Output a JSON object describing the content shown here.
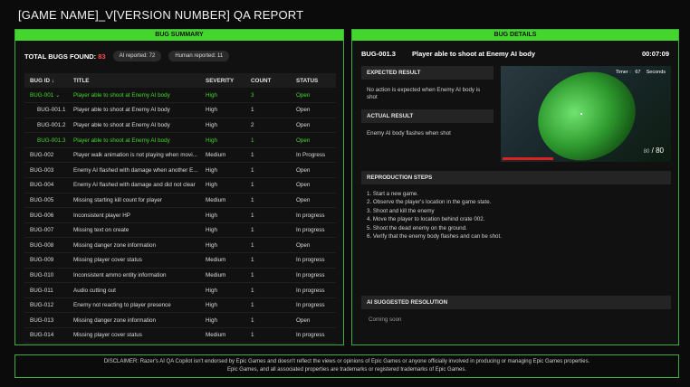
{
  "page_title": "[GAME NAME]_V[VERSION NUMBER] QA REPORT",
  "summary": {
    "header": "BUG SUMMARY",
    "total_label": "TOTAL BUGS FOUND:",
    "total_count": "83",
    "ai_reported": "AI reported: 72",
    "human_reported": "Human reported: 11",
    "columns": [
      "BUG ID ↓",
      "TITLE",
      "SEVERITY",
      "COUNT",
      "STATUS"
    ],
    "rows": [
      {
        "id": "BUG-001 ⌄",
        "title": "Player able to shoot at Enemy AI body",
        "severity": "High",
        "count": "3",
        "status": "Open",
        "kind": "parent"
      },
      {
        "id": "BUG-001.1",
        "title": "Player able to shoot at Enemy AI body",
        "severity": "High",
        "count": "1",
        "status": "Open",
        "kind": "child"
      },
      {
        "id": "BUG-001.2",
        "title": "Player able to shoot at Enemy AI body",
        "severity": "High",
        "count": "2",
        "status": "Open",
        "kind": "child"
      },
      {
        "id": "BUG-001.3",
        "title": "Player able to shoot at Enemy AI body",
        "severity": "High",
        "count": "1",
        "status": "Open",
        "kind": "child-hl"
      },
      {
        "id": "BUG-002",
        "title": "Player walk animation is not playing when movi...",
        "severity": "Medium",
        "count": "1",
        "status": "In Progress",
        "kind": "normal"
      },
      {
        "id": "BUG-003",
        "title": "Enemy AI flashed with damage when another E...",
        "severity": "High",
        "count": "1",
        "status": "Open",
        "kind": "normal"
      },
      {
        "id": "BUG-004",
        "title": "Enemy AI flashed with damage and did not clear",
        "severity": "High",
        "count": "1",
        "status": "Open",
        "kind": "normal"
      },
      {
        "id": "BUG-005",
        "title": "Missing starting kill count for player",
        "severity": "Medium",
        "count": "1",
        "status": "Open",
        "kind": "normal"
      },
      {
        "id": "BUG-006",
        "title": "Inconsistent player HP",
        "severity": "High",
        "count": "1",
        "status": "In progress",
        "kind": "normal"
      },
      {
        "id": "BUG-007",
        "title": "Missing text on create",
        "severity": "High",
        "count": "1",
        "status": "In progress",
        "kind": "normal"
      },
      {
        "id": "BUG-008",
        "title": "Missing danger zone information",
        "severity": "High",
        "count": "1",
        "status": "Open",
        "kind": "normal"
      },
      {
        "id": "BUG-009",
        "title": "Missing player cover status",
        "severity": "Medium",
        "count": "1",
        "status": "In progress",
        "kind": "normal"
      },
      {
        "id": "BUG-010",
        "title": "Inconsistent ammo entity information",
        "severity": "Medium",
        "count": "1",
        "status": "In progress",
        "kind": "normal"
      },
      {
        "id": "BUG-011",
        "title": "Audio cutting out",
        "severity": "High",
        "count": "1",
        "status": "In progress",
        "kind": "normal"
      },
      {
        "id": "BUG-012",
        "title": "Enemy not reacting to player presence",
        "severity": "High",
        "count": "1",
        "status": "In progress",
        "kind": "normal"
      },
      {
        "id": "BUG-013",
        "title": "Missing danger zone information",
        "severity": "High",
        "count": "1",
        "status": "Open",
        "kind": "normal"
      },
      {
        "id": "BUG-014",
        "title": "Missing player cover status",
        "severity": "Medium",
        "count": "1",
        "status": "In progress",
        "kind": "normal"
      }
    ]
  },
  "details": {
    "header": "BUG DETAILS",
    "bug_id": "BUG-001.3",
    "bug_title": "Player able to shoot at Enemy AI body",
    "timestamp": "00:07:09",
    "expected_label": "EXPECTED RESULT",
    "expected_text": "No action is expected when Enemy AI body is shot",
    "actual_label": "ACTUAL RESULT",
    "actual_text": "Enemy AI body flashes when shot",
    "video": {
      "timer_label": "Timer :",
      "timer_value": "67",
      "timer_unit": "Seconds",
      "ammo_current": "80",
      "ammo_sep": "/",
      "ammo_max": "80"
    },
    "repro_label": "REPRODUCTION STEPS",
    "repro_steps": [
      "1. Start a new game.",
      "2. Observe the player's location in the game state.",
      "3. Shoot and kill the enemy",
      "4. Move the player to location behind crate 002.",
      "5. Shoot the dead enemy on the ground.",
      "6. Verify that the enemy body flashes and can be shot."
    ],
    "ai_label": "AI SUGGESTED RESOLUTION",
    "ai_text": "Coming soon"
  },
  "disclaimer": {
    "line1": "DISCLAIMER: Razer's AI QA Copilot isn't endorsed by Epic Games and doesn't reflect the views or opinions of Epic Games or anyone officially involved in producing or managing Epic Games properties.",
    "line2": "Epic Games, and all associated properties are trademarks or registered trademarks of Epic Games."
  },
  "colors": {
    "accent": "#44d62c",
    "count_red": "#ff4d4d"
  }
}
